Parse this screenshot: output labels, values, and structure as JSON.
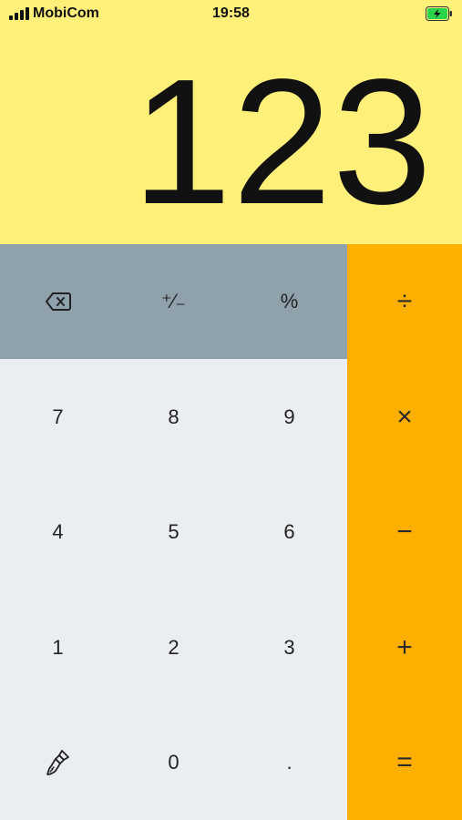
{
  "status_bar": {
    "carrier": "MobiCom",
    "time": "19:58",
    "signal_icon": "signal-bars-icon",
    "battery_icon": "battery-charging-icon",
    "battery_color": "#2bd34a"
  },
  "display": {
    "value": "123"
  },
  "keys": {
    "backspace_icon": "backspace-icon",
    "plus_minus": "⁺⁄₋",
    "percent": "%",
    "divide": "÷",
    "seven": "7",
    "eight": "8",
    "nine": "9",
    "multiply": "×",
    "four": "4",
    "five": "5",
    "six": "6",
    "minus": "−",
    "one": "1",
    "two": "2",
    "three": "3",
    "plus": "+",
    "brush_icon": "paint-brush-icon",
    "zero": "0",
    "decimal": ".",
    "equals": "="
  },
  "colors": {
    "display_bg": "#fff07a",
    "function_row_bg": "#8fa2ac",
    "number_keys_bg": "#eaeef2",
    "operator_column_bg": "#ffaf00"
  }
}
